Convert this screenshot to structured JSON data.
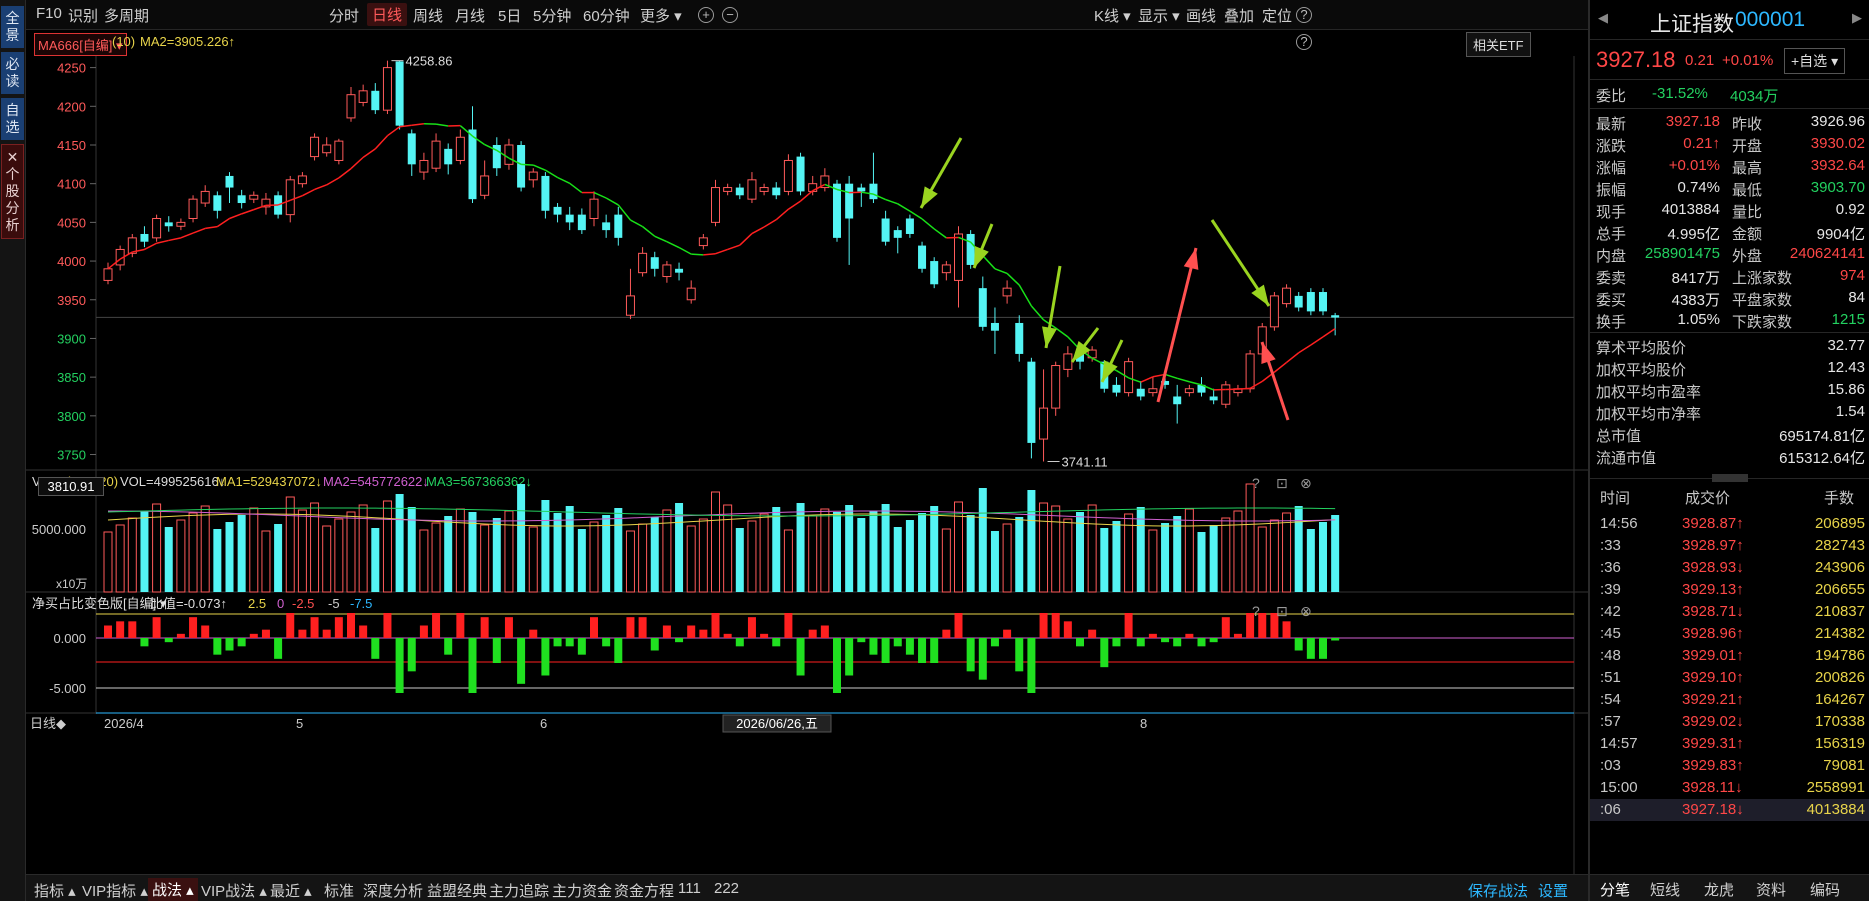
{
  "leftbar": {
    "tabs": [
      "全景",
      "必读",
      "自选",
      "✕ 个股分析"
    ]
  },
  "topbar": {
    "left": [
      "F10",
      "识别",
      "多周期"
    ],
    "periods": [
      "分时",
      "日线",
      "周线",
      "月线",
      "5日",
      "5分钟",
      "60分钟",
      "更多 ▾"
    ],
    "active_period": "日线",
    "zoom_in": "+",
    "zoom_out": "−",
    "right": [
      "K线 ▾",
      "显示 ▾",
      "画线",
      "叠加",
      "定位"
    ],
    "help": "?"
  },
  "infobar": {
    "ma_select": "MA666[自编] ▾",
    "ma_param": "(10)",
    "ma2_text": "MA2=3905.226↑",
    "etf_button": "相关ETF",
    "help": "?"
  },
  "price_chart": {
    "y_ticks": [
      "4250",
      "4200",
      "4150",
      "4100",
      "4050",
      "4000",
      "3950",
      "3900",
      "3850",
      "3800",
      "3750"
    ],
    "max_label": "4258.86",
    "min_label": "3741.11",
    "crosshair_price": "3810.91",
    "up_color": "#ff5a5a",
    "down_color": "#54f4f4",
    "ma_rise_color": "#ff2020",
    "ma_fall_color": "#18e018"
  },
  "volume_panel": {
    "select": "VOL ▾",
    "params": "(5,10,20)",
    "vol_text": "VOL=499525616↓",
    "ma1_text": "MA1=529437072↓",
    "ma2_text": "MA2=545772622↓",
    "ma3_text": "MA3=567366362↓",
    "y_tick": "5000.000",
    "unit": "x10万",
    "icons": [
      "?",
      "⊡",
      "⊗"
    ]
  },
  "netbuy_panel": {
    "select": "净买占比变色版[自编] ▾",
    "ratio_text": "比值=-0.073↑",
    "levels": [
      "2.5",
      "0",
      "-2.5",
      "-5",
      "-7.5"
    ],
    "y_ticks": [
      "0.000",
      "-5.000"
    ],
    "icons": [
      "?",
      "⊡",
      "⊗"
    ]
  },
  "x_axis": {
    "period_label": "日线◆",
    "labels": [
      "2026/4",
      "5",
      "6",
      "8"
    ],
    "cursor_date": "2026/06/26,五"
  },
  "bottom_tabs": {
    "items": [
      "指标 ▴",
      "VIP指标 ▴",
      "战法 ▴",
      "VIP战法 ▴",
      "最近 ▴",
      "标准",
      "深度分析",
      "益盟经典",
      "主力追踪",
      "主力资金",
      "资金方程",
      "111",
      "222"
    ],
    "active": "战法 ▴",
    "right": [
      "保存战法",
      "设置"
    ]
  },
  "quote": {
    "name": "上证指数",
    "code": "000001",
    "price": "3927.18",
    "change": "0.21",
    "change_pct": "+0.01%",
    "add_watch": "+自选 ▾",
    "weibi_label": "委比",
    "weibi": "-31.52%",
    "weicha": "4034万",
    "rows": [
      {
        "l1": "最新",
        "v1": "3927.18",
        "c1": "red",
        "l2": "昨收",
        "v2": "3926.96",
        "c2": "white"
      },
      {
        "l1": "涨跌",
        "v1": "0.21↑",
        "c1": "red",
        "l2": "开盘",
        "v2": "3930.02",
        "c2": "red"
      },
      {
        "l1": "涨幅",
        "v1": "+0.01%",
        "c1": "red",
        "l2": "最高",
        "v2": "3932.64",
        "c2": "red"
      },
      {
        "l1": "振幅",
        "v1": "0.74%",
        "c1": "white",
        "l2": "最低",
        "v2": "3903.70",
        "c2": "green"
      },
      {
        "l1": "现手",
        "v1": "4013884",
        "c1": "white",
        "l2": "量比",
        "v2": "0.92",
        "c2": "white"
      },
      {
        "l1": "总手",
        "v1": "4.995亿",
        "c1": "white",
        "l2": "金额",
        "v2": "9904亿",
        "c2": "white"
      },
      {
        "l1": "内盘",
        "v1": "258901475",
        "c1": "green",
        "l2": "外盘",
        "v2": "240624141",
        "c2": "red"
      },
      {
        "l1": "委卖",
        "v1": "8417万",
        "c1": "white",
        "l2": "上涨家数",
        "v2": "974",
        "c2": "red"
      },
      {
        "l1": "委买",
        "v1": "4383万",
        "c1": "white",
        "l2": "平盘家数",
        "v2": "84",
        "c2": "white"
      },
      {
        "l1": "换手",
        "v1": "1.05%",
        "c1": "white",
        "l2": "下跌家数",
        "v2": "1215",
        "c2": "green"
      }
    ],
    "stats": [
      {
        "label": "算术平均股价",
        "value": "32.77"
      },
      {
        "label": "加权平均股价",
        "value": "12.43"
      },
      {
        "label": "加权平均市盈率",
        "value": "15.86"
      },
      {
        "label": "加权平均市净率",
        "value": "1.54"
      },
      {
        "label": "总市值",
        "value": "695174.81亿"
      },
      {
        "label": "流通市值",
        "value": "615312.64亿"
      }
    ]
  },
  "ticks": {
    "headers": [
      "时间",
      "成交价",
      "手数"
    ],
    "rows": [
      {
        "time": "14:56",
        "price": "3928.87↑",
        "pc": "red",
        "vol": "206895"
      },
      {
        "time": ":33",
        "price": "3928.97↑",
        "pc": "red",
        "vol": "282743"
      },
      {
        "time": ":36",
        "price": "3928.93↓",
        "pc": "red",
        "vol": "243906"
      },
      {
        "time": ":39",
        "price": "3929.13↑",
        "pc": "red",
        "vol": "206655"
      },
      {
        "time": ":42",
        "price": "3928.71↓",
        "pc": "red",
        "vol": "210837"
      },
      {
        "time": ":45",
        "price": "3928.96↑",
        "pc": "red",
        "vol": "214382"
      },
      {
        "time": ":48",
        "price": "3929.01↑",
        "pc": "red",
        "vol": "194786"
      },
      {
        "time": ":51",
        "price": "3929.10↑",
        "pc": "red",
        "vol": "200826"
      },
      {
        "time": ":54",
        "price": "3929.21↑",
        "pc": "red",
        "vol": "164267"
      },
      {
        "time": ":57",
        "price": "3929.02↓",
        "pc": "red",
        "vol": "170338"
      },
      {
        "time": "14:57",
        "price": "3929.31↑",
        "pc": "red",
        "vol": "156319"
      },
      {
        "time": ":03",
        "price": "3929.83↑",
        "pc": "red",
        "vol": "79081"
      },
      {
        "time": "15:00",
        "price": "3928.11↓",
        "pc": "red",
        "vol": "2558991"
      },
      {
        "time": ":06",
        "price": "3927.18↓",
        "pc": "red",
        "vol": "4013884"
      }
    ]
  },
  "right_tabs": {
    "items": [
      "分笔",
      "短线",
      "龙虎",
      "资料",
      "编码"
    ],
    "active": "分笔"
  },
  "chart_data": {
    "type": "candlestick",
    "ylim": [
      3730,
      4265
    ],
    "candles": [
      {
        "o": 3975,
        "c": 3990,
        "h": 3998,
        "l": 3970
      },
      {
        "o": 3995,
        "c": 4015,
        "h": 4020,
        "l": 3988
      },
      {
        "o": 4010,
        "c": 4030,
        "h": 4035,
        "l": 4005
      },
      {
        "o": 4035,
        "c": 4025,
        "h": 4045,
        "l": 4018
      },
      {
        "o": 4030,
        "c": 4055,
        "h": 4060,
        "l": 4025
      },
      {
        "o": 4050,
        "c": 4045,
        "h": 4058,
        "l": 4038
      },
      {
        "o": 4045,
        "c": 4050,
        "h": 4055,
        "l": 4040
      },
      {
        "o": 4055,
        "c": 4080,
        "h": 4085,
        "l": 4050
      },
      {
        "o": 4075,
        "c": 4090,
        "h": 4098,
        "l": 4070
      },
      {
        "o": 4085,
        "c": 4065,
        "h": 4090,
        "l": 4055
      },
      {
        "o": 4110,
        "c": 4095,
        "h": 4115,
        "l": 4075
      },
      {
        "o": 4085,
        "c": 4075,
        "h": 4092,
        "l": 4068
      },
      {
        "o": 4080,
        "c": 4085,
        "h": 4090,
        "l": 4075
      },
      {
        "o": 4070,
        "c": 4080,
        "h": 4088,
        "l": 4060
      },
      {
        "o": 4085,
        "c": 4060,
        "h": 4090,
        "l": 4055
      },
      {
        "o": 4060,
        "c": 4105,
        "h": 4110,
        "l": 4050
      },
      {
        "o": 4100,
        "c": 4110,
        "h": 4115,
        "l": 4095
      },
      {
        "o": 4135,
        "c": 4160,
        "h": 4165,
        "l": 4130
      },
      {
        "o": 4140,
        "c": 4150,
        "h": 4160,
        "l": 4135
      },
      {
        "o": 4130,
        "c": 4155,
        "h": 4158,
        "l": 4125
      },
      {
        "o": 4185,
        "c": 4215,
        "h": 4225,
        "l": 4180
      },
      {
        "o": 4205,
        "c": 4220,
        "h": 4228,
        "l": 4200
      },
      {
        "o": 4220,
        "c": 4195,
        "h": 4230,
        "l": 4190
      },
      {
        "o": 4195,
        "c": 4250,
        "h": 4259,
        "l": 4190
      },
      {
        "o": 4258,
        "c": 4175,
        "h": 4259,
        "l": 4170
      },
      {
        "o": 4165,
        "c": 4125,
        "h": 4170,
        "l": 4110
      },
      {
        "o": 4115,
        "c": 4130,
        "h": 4140,
        "l": 4105
      },
      {
        "o": 4120,
        "c": 4155,
        "h": 4165,
        "l": 4115
      },
      {
        "o": 4145,
        "c": 4125,
        "h": 4152,
        "l": 4112
      },
      {
        "o": 4130,
        "c": 4160,
        "h": 4170,
        "l": 4125
      },
      {
        "o": 4170,
        "c": 4080,
        "h": 4200,
        "l": 4075
      },
      {
        "o": 4085,
        "c": 4110,
        "h": 4130,
        "l": 4080
      },
      {
        "o": 4150,
        "c": 4120,
        "h": 4160,
        "l": 4110
      },
      {
        "o": 4125,
        "c": 4150,
        "h": 4158,
        "l": 4118
      },
      {
        "o": 4150,
        "c": 4095,
        "h": 4155,
        "l": 4090
      },
      {
        "o": 4105,
        "c": 4115,
        "h": 4120,
        "l": 4095
      },
      {
        "o": 4110,
        "c": 4065,
        "h": 4115,
        "l": 4055
      },
      {
        "o": 4070,
        "c": 4060,
        "h": 4075,
        "l": 4050
      },
      {
        "o": 4060,
        "c": 4050,
        "h": 4070,
        "l": 4040
      },
      {
        "o": 4060,
        "c": 4040,
        "h": 4068,
        "l": 4035
      },
      {
        "o": 4055,
        "c": 4080,
        "h": 4090,
        "l": 4045
      },
      {
        "o": 4050,
        "c": 4040,
        "h": 4060,
        "l": 4030
      },
      {
        "o": 4060,
        "c": 4030,
        "h": 4070,
        "l": 4020
      },
      {
        "o": 3930,
        "c": 3955,
        "h": 3990,
        "l": 3925
      },
      {
        "o": 3985,
        "c": 4010,
        "h": 4018,
        "l": 3980
      },
      {
        "o": 4005,
        "c": 3990,
        "h": 4012,
        "l": 3980
      },
      {
        "o": 3980,
        "c": 3995,
        "h": 4000,
        "l": 3972
      },
      {
        "o": 3990,
        "c": 3985,
        "h": 3998,
        "l": 3975
      },
      {
        "o": 3950,
        "c": 3965,
        "h": 3975,
        "l": 3945
      },
      {
        "o": 4020,
        "c": 4030,
        "h": 4035,
        "l": 4015
      },
      {
        "o": 4050,
        "c": 4095,
        "h": 4105,
        "l": 4045
      },
      {
        "o": 4090,
        "c": 4095,
        "h": 4100,
        "l": 4085
      },
      {
        "o": 4095,
        "c": 4085,
        "h": 4100,
        "l": 4080
      },
      {
        "o": 4080,
        "c": 4105,
        "h": 4115,
        "l": 4075
      },
      {
        "o": 4090,
        "c": 4095,
        "h": 4100,
        "l": 4085
      },
      {
        "o": 4095,
        "c": 4085,
        "h": 4102,
        "l": 4080
      },
      {
        "o": 4090,
        "c": 4130,
        "h": 4138,
        "l": 4085
      },
      {
        "o": 4135,
        "c": 4090,
        "h": 4140,
        "l": 4085
      },
      {
        "o": 4090,
        "c": 4100,
        "h": 4110,
        "l": 4085
      },
      {
        "o": 4095,
        "c": 4110,
        "h": 4120,
        "l": 4090
      },
      {
        "o": 4100,
        "c": 4030,
        "h": 4105,
        "l": 4025
      },
      {
        "o": 4100,
        "c": 4055,
        "h": 4110,
        "l": 3995
      },
      {
        "o": 4095,
        "c": 4090,
        "h": 4100,
        "l": 4070
      },
      {
        "o": 4100,
        "c": 4080,
        "h": 4140,
        "l": 4075
      },
      {
        "o": 4055,
        "c": 4025,
        "h": 4065,
        "l": 4020
      },
      {
        "o": 4040,
        "c": 4030,
        "h": 4045,
        "l": 4010
      },
      {
        "o": 4055,
        "c": 4035,
        "h": 4060,
        "l": 4030
      },
      {
        "o": 4020,
        "c": 3990,
        "h": 4025,
        "l": 3985
      },
      {
        "o": 4000,
        "c": 3970,
        "h": 4005,
        "l": 3965
      },
      {
        "o": 3985,
        "c": 3995,
        "h": 4000,
        "l": 3975
      },
      {
        "o": 3975,
        "c": 4035,
        "h": 4045,
        "l": 3940
      },
      {
        "o": 4035,
        "c": 3995,
        "h": 4040,
        "l": 3990
      },
      {
        "o": 3965,
        "c": 3915,
        "h": 3980,
        "l": 3910
      },
      {
        "o": 3920,
        "c": 3910,
        "h": 3940,
        "l": 3880
      },
      {
        "o": 3955,
        "c": 3965,
        "h": 3975,
        "l": 3945
      },
      {
        "o": 3920,
        "c": 3880,
        "h": 3930,
        "l": 3870
      },
      {
        "o": 3870,
        "c": 3765,
        "h": 3875,
        "l": 3745
      },
      {
        "o": 3770,
        "c": 3810,
        "h": 3860,
        "l": 3741
      },
      {
        "o": 3810,
        "c": 3865,
        "h": 3870,
        "l": 3800
      },
      {
        "o": 3860,
        "c": 3880,
        "h": 3890,
        "l": 3850
      },
      {
        "o": 3880,
        "c": 3870,
        "h": 3885,
        "l": 3860
      },
      {
        "o": 3875,
        "c": 3885,
        "h": 3890,
        "l": 3870
      },
      {
        "o": 3870,
        "c": 3835,
        "h": 3872,
        "l": 3830
      },
      {
        "o": 3840,
        "c": 3830,
        "h": 3850,
        "l": 3825
      },
      {
        "o": 3830,
        "c": 3870,
        "h": 3875,
        "l": 3825
      },
      {
        "o": 3835,
        "c": 3825,
        "h": 3845,
        "l": 3820
      },
      {
        "o": 3830,
        "c": 3835,
        "h": 3850,
        "l": 3825
      },
      {
        "o": 3845,
        "c": 3840,
        "h": 3855,
        "l": 3835
      },
      {
        "o": 3825,
        "c": 3815,
        "h": 3840,
        "l": 3790
      },
      {
        "o": 3830,
        "c": 3835,
        "h": 3840,
        "l": 3825
      },
      {
        "o": 3840,
        "c": 3830,
        "h": 3850,
        "l": 3825
      },
      {
        "o": 3825,
        "c": 3820,
        "h": 3835,
        "l": 3815
      },
      {
        "o": 3815,
        "c": 3840,
        "h": 3845,
        "l": 3810
      },
      {
        "o": 3830,
        "c": 3835,
        "h": 3840,
        "l": 3825
      },
      {
        "o": 3835,
        "c": 3880,
        "h": 3885,
        "l": 3830
      },
      {
        "o": 3880,
        "c": 3915,
        "h": 3920,
        "l": 3875
      },
      {
        "o": 3915,
        "c": 3955,
        "h": 3960,
        "l": 3910
      },
      {
        "o": 3945,
        "c": 3965,
        "h": 3970,
        "l": 3940
      },
      {
        "o": 3955,
        "c": 3940,
        "h": 3960,
        "l": 3935
      },
      {
        "o": 3960,
        "c": 3935,
        "h": 3965,
        "l": 3930
      },
      {
        "o": 3960,
        "c": 3935,
        "h": 3965,
        "l": 3930
      },
      {
        "o": 3930,
        "c": 3927,
        "h": 3933,
        "l": 3904
      }
    ]
  }
}
